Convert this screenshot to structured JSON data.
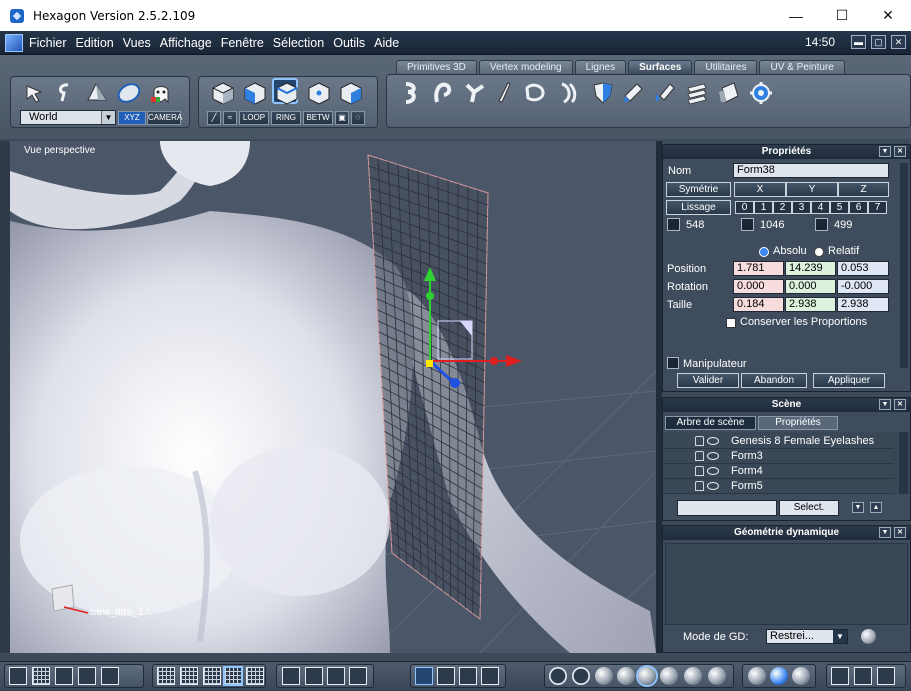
{
  "window": {
    "title": "Hexagon Version 2.5.2.109",
    "min": "—",
    "max": "☐",
    "close": "✕"
  },
  "menu": {
    "items": [
      "Fichier",
      "Edition",
      "Vues",
      "Affichage",
      "Fenêtre",
      "Sélection",
      "Outils",
      "Aide"
    ],
    "clock": "14:50"
  },
  "toolbar": {
    "tabs": [
      "Primitives 3D",
      "Vertex modeling",
      "Lignes",
      "Surfaces",
      "Utilitaires",
      "UV & Peinture"
    ],
    "active_tab": "Surfaces",
    "coord_space": "World",
    "xyz": "XYZ",
    "camera": "CAMERA",
    "loop": "LOOP",
    "ring": "RING",
    "betw": "BETW"
  },
  "viewport": {
    "label": "Vue perspective",
    "scene_name": "sans_titre_1 *"
  },
  "properties": {
    "title": "Propriétés",
    "nom_label": "Nom",
    "nom_value": "Form38",
    "symetrie": "Symétrie",
    "axes": [
      "X",
      "Y",
      "Z"
    ],
    "lissage": "Lissage",
    "lissage_levels": [
      "0",
      "1",
      "2",
      "3",
      "4",
      "5",
      "6",
      "7"
    ],
    "counts": [
      "548",
      "1046",
      "499"
    ],
    "absolu": "Absolu",
    "relatif": "Relatif",
    "position_label": "Position",
    "position": [
      "1.781",
      "14.239",
      "0.053"
    ],
    "rotation_label": "Rotation",
    "rotation": [
      "0.000",
      "0.000",
      "-0.000"
    ],
    "taille_label": "Taille",
    "taille": [
      "0.184",
      "2.938",
      "2.938"
    ],
    "conserver": "Conserver les Proportions",
    "manipulateur": "Manipulateur",
    "valider": "Valider",
    "abandon": "Abandon",
    "appliquer": "Appliquer"
  },
  "scene": {
    "title": "Scène",
    "tabs": [
      "Arbre de scène",
      "Propriétés"
    ],
    "items": [
      "Genesis 8 Female Eyelashes",
      "Form3",
      "Form4",
      "Form5"
    ],
    "select_btn": "Select."
  },
  "geometry": {
    "title": "Géométrie dynamique",
    "mode_label": "Mode de GD:",
    "mode_value": "Restrei..."
  }
}
